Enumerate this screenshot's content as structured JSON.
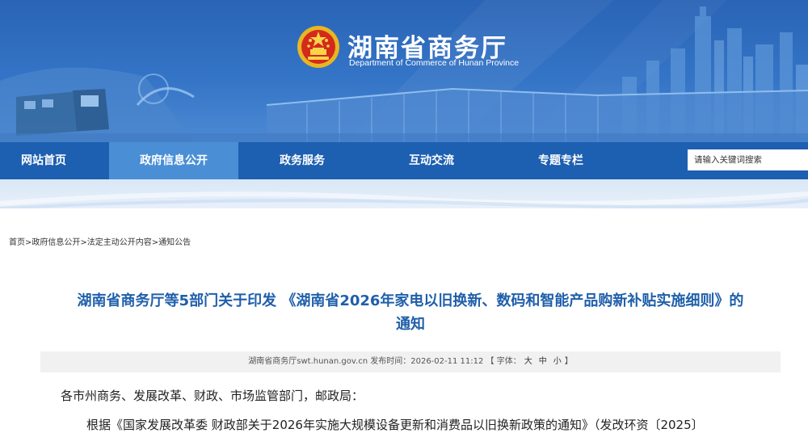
{
  "header": {
    "title": "湖南省商务厅",
    "subtitle": "Department of Commerce of Hunan Province",
    "emblem_icon": "national-emblem-icon"
  },
  "nav": {
    "items": [
      {
        "label": "网站首页",
        "active": false
      },
      {
        "label": "政府信息公开",
        "active": true
      },
      {
        "label": "政务服务",
        "active": false
      },
      {
        "label": "互动交流",
        "active": false
      },
      {
        "label": "专题专栏",
        "active": false
      }
    ],
    "search_placeholder": "请输入关键词搜索"
  },
  "breadcrumb": {
    "items": [
      "首页",
      "政府信息公开",
      "法定主动公开内容",
      "通知公告"
    ],
    "separator": ">"
  },
  "article": {
    "title_line1": "湖南省商务厅等5部门关于印发 《湖南省2026年家电以旧换新、数码和智能产品购新补贴实施细则》的",
    "title_line2": "通知",
    "meta": {
      "source": "湖南省商务厅swt.hunan.gov.cn",
      "published_label": "发布时间：",
      "published": "2026-02-11 11:12",
      "font_label": "【 字体：",
      "font_large": "大",
      "font_medium": "中",
      "font_small": "小",
      "font_close": "】"
    },
    "paragraph1": "各市州商务、发展改革、财政、市场监管部门，邮政局：",
    "paragraph2": "根据《国家发展改革委 财政部关于2026年实施大规模设备更新和消费品以旧换新政策的通知》（发改环资〔2025〕"
  },
  "colors": {
    "banner": "#2a64b6",
    "nav": "#1d5fb0",
    "nav_active": "#4a8fd6",
    "title": "#1f5faa",
    "meta_bg": "#f1f1f1"
  }
}
